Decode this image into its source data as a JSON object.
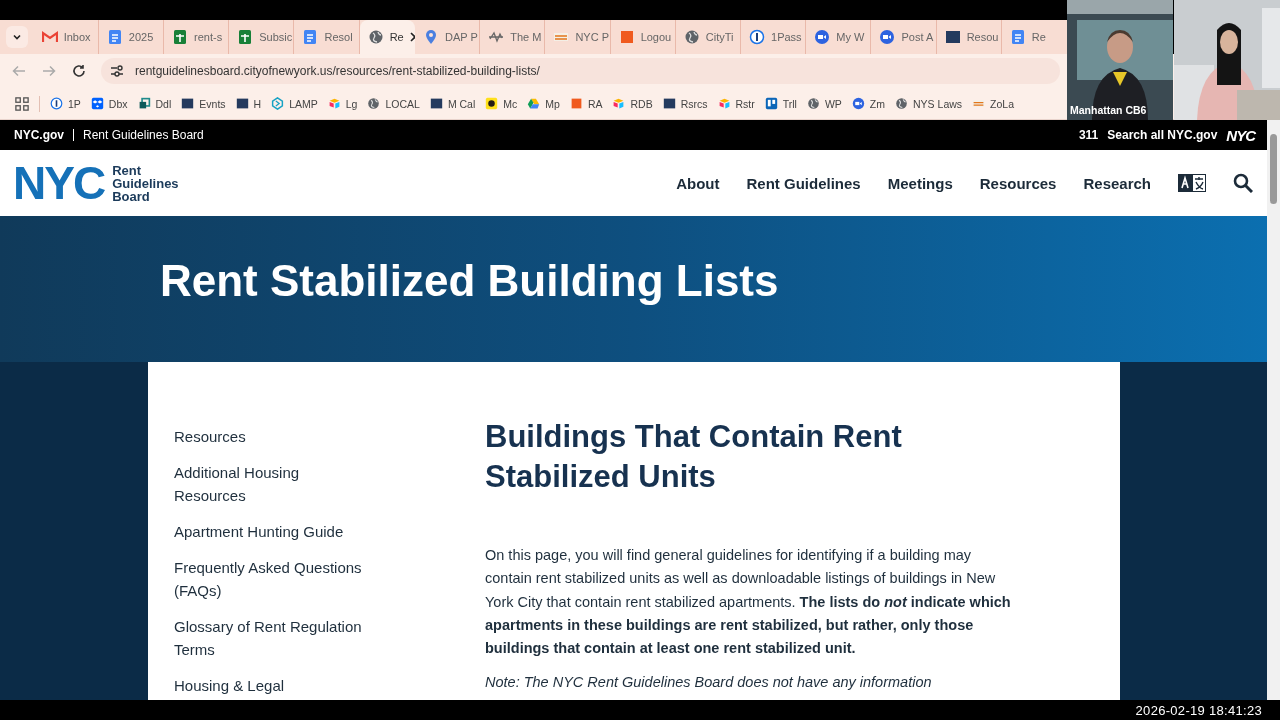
{
  "browser": {
    "tabs": [
      {
        "label": "Inbox",
        "kind": "mail",
        "selected": false
      },
      {
        "label": "2025",
        "kind": "doc",
        "selected": false
      },
      {
        "label": "rent-s",
        "kind": "sheet",
        "selected": false
      },
      {
        "label": "Subsic",
        "kind": "sheet",
        "selected": false
      },
      {
        "label": "Resol",
        "kind": "doc",
        "selected": false
      },
      {
        "label": "Re",
        "kind": "globe",
        "selected": true
      },
      {
        "label": "DAP P",
        "kind": "pin",
        "selected": false
      },
      {
        "label": "The M",
        "kind": "scribble",
        "selected": false
      },
      {
        "label": "NYC P",
        "kind": "nyc",
        "selected": false
      },
      {
        "label": "Logou",
        "kind": "square",
        "selected": false
      },
      {
        "label": "CityTi",
        "kind": "globe",
        "selected": false
      },
      {
        "label": "1Pass",
        "kind": "onepass",
        "selected": false
      },
      {
        "label": "My W",
        "kind": "zoom",
        "selected": false
      },
      {
        "label": "Post A",
        "kind": "zoom",
        "selected": false
      },
      {
        "label": "Resou",
        "kind": "cb6",
        "selected": false
      },
      {
        "label": "Re",
        "kind": "doc",
        "selected": false
      }
    ],
    "url": "rentguidelinesboard.cityofnewyork.us/resources/rent-stabilized-building-lists/",
    "bookmarks": [
      {
        "label": "1P",
        "kind": "onepass"
      },
      {
        "label": "Dbx",
        "kind": "dropbox"
      },
      {
        "label": "Ddl",
        "kind": "ddl"
      },
      {
        "label": "Evnts",
        "kind": "cb6"
      },
      {
        "label": "H",
        "kind": "cb6"
      },
      {
        "label": "LAMP",
        "kind": "lamp"
      },
      {
        "label": "Lg",
        "kind": "airtable"
      },
      {
        "label": "LOCAL",
        "kind": "globe"
      },
      {
        "label": "M Cal",
        "kind": "cb6"
      },
      {
        "label": "Mc",
        "kind": "mailchimp"
      },
      {
        "label": "Mp",
        "kind": "drive"
      },
      {
        "label": "RA",
        "kind": "square"
      },
      {
        "label": "RDB",
        "kind": "airtable"
      },
      {
        "label": "Rsrcs",
        "kind": "cb6"
      },
      {
        "label": "Rstr",
        "kind": "airtable"
      },
      {
        "label": "Trll",
        "kind": "trello"
      },
      {
        "label": "WP",
        "kind": "globe"
      },
      {
        "label": "Zm",
        "kind": "zoom"
      },
      {
        "label": "NYS Laws",
        "kind": "globe"
      },
      {
        "label": "ZoLa",
        "kind": "nyc"
      }
    ]
  },
  "gov_bar": {
    "site": "NYC.gov",
    "section": "Rent Guidelines Board",
    "phone": "311",
    "search": "Search all NYC.gov",
    "logo": "NYC"
  },
  "header": {
    "logo": "NYC",
    "logo_lines": [
      "Rent",
      "Guidelines",
      "Board"
    ],
    "nav": [
      "About",
      "Rent Guidelines",
      "Meetings",
      "Resources",
      "Research"
    ]
  },
  "hero": {
    "title": "Rent Stabilized Building Lists"
  },
  "sidebar": [
    "Resources",
    "Additional Housing Resources",
    "Apartment Hunting Guide",
    "Frequently Asked Questions (FAQs)",
    "Glossary of Rent Regulation Terms",
    "Housing & Legal"
  ],
  "content": {
    "heading": "Buildings That Contain Rent Stabilized Units",
    "intro": [
      {
        "text": "On this page, you will find general guidelines for identifying if a building may contain rent stabilized units as well as downloadable listings of buildings in New York City that contain rent stabilized apartments. ",
        "bold": false,
        "italic": false
      },
      {
        "text": "The lists do ",
        "bold": true,
        "italic": false
      },
      {
        "text": "not",
        "bold": true,
        "italic": true
      },
      {
        "text": " indicate which apartments in these buildings are rent stabilized, but rather, only those buildings that contain at least one rent stabilized unit.",
        "bold": true,
        "italic": false
      }
    ],
    "note": "Note: The NYC Rent Guidelines Board does not have any information"
  },
  "video": {
    "caption": "Manhattan CB6"
  },
  "timestamp": "2026-02-19 18:41:23"
}
